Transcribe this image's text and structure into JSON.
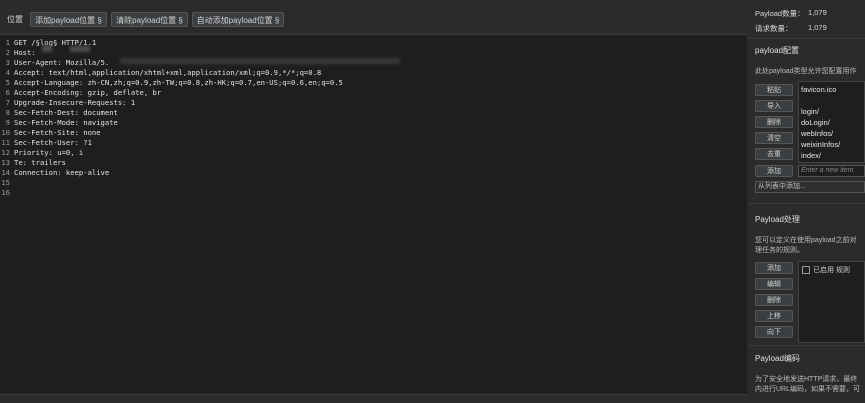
{
  "toolbar": {
    "position_label": "位置",
    "add_button": "添加payload位置 §",
    "clear_button": "清除payload位置 §",
    "auto_button": "自动添加payload位置 §"
  },
  "editor": {
    "lines": [
      {
        "num": "1",
        "text": "GET /§log§ HTTP/1.1"
      },
      {
        "num": "2",
        "text": "Host:"
      },
      {
        "num": "3",
        "text": "User-Agent: Mozilla/5."
      },
      {
        "num": "4",
        "text": "Accept: text/html,application/xhtml+xml,application/xml;q=0.9,*/*;q=0.8"
      },
      {
        "num": "5",
        "text": "Accept-Language: zh-CN,zh;q=0.9,zh-TW;q=0.8,zh-HK;q=0.7,en-US;q=0.6,en;q=0.5"
      },
      {
        "num": "6",
        "text": "Accept-Encoding: gzip, deflate, br"
      },
      {
        "num": "7",
        "text": "Upgrade-Insecure-Requests: 1"
      },
      {
        "num": "8",
        "text": "Sec-Fetch-Dest: document"
      },
      {
        "num": "9",
        "text": "Sec-Fetch-Mode: navigate"
      },
      {
        "num": "10",
        "text": "Sec-Fetch-Site: none"
      },
      {
        "num": "11",
        "text": "Sec-Fetch-User: ?1"
      },
      {
        "num": "12",
        "text": "Priority: u=0, i"
      },
      {
        "num": "13",
        "text": "Te: trailers"
      },
      {
        "num": "14",
        "text": "Connection: keep-alive"
      },
      {
        "num": "15",
        "text": ""
      },
      {
        "num": "16",
        "text": ""
      }
    ]
  },
  "sidebar": {
    "payload_count_label": "Payload数量：",
    "payload_count_value": "1,079",
    "request_count_label": "请求数量：",
    "request_count_value": "1,079",
    "config_title": "payload配置",
    "config_desc": "此处payload类型允许您配置用作",
    "config_buttons": [
      "粘贴",
      "导入",
      "删除",
      "清空",
      "去重",
      "添加"
    ],
    "config_items": [
      "favicon.ico",
      "login/",
      "doLogin/",
      "webInfos/",
      "weixinInfos/",
      "index/"
    ],
    "new_item_placeholder": "Enter a new item",
    "add_from_list": "从列表中添加...",
    "processing_title": "Payload处理",
    "processing_desc_1": "您可以定义在使用payload之前对",
    "processing_desc_2": "理任务的规则。",
    "processing_buttons": [
      "添加",
      "编辑",
      "删除",
      "上移",
      "向下"
    ],
    "enabled_rule_label": "已启用 规则",
    "encoding_title": "Payload编码",
    "encoding_desc_1": "为了安全地发送HTTP请求，最终",
    "encoding_desc_2": "内进行URL编码，如果不需要，可"
  }
}
